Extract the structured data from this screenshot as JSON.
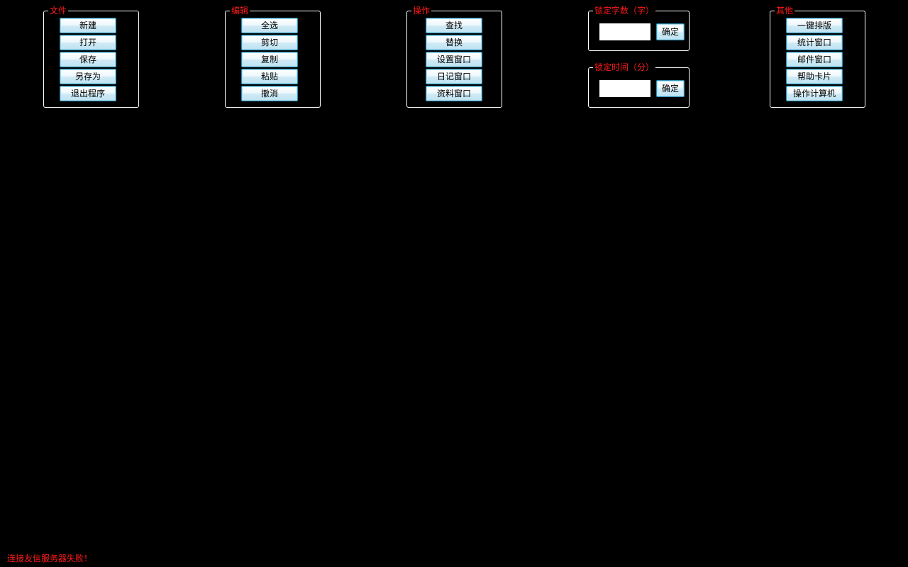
{
  "theme": {
    "background": "#000000",
    "title_color": "#ff1a1a",
    "border_color": "#ffffff",
    "button_border": "#2e8fb7"
  },
  "file_group": {
    "title": "文件",
    "buttons": [
      "新建",
      "打开",
      "保存",
      "另存为",
      "退出程序"
    ]
  },
  "edit_group": {
    "title": "编辑",
    "buttons": [
      "全选",
      "剪切",
      "复制",
      "粘贴",
      "撤消"
    ]
  },
  "operate_group": {
    "title": "操作",
    "buttons": [
      "查找",
      "替换",
      "设置窗口",
      "日记窗口",
      "资料窗口"
    ]
  },
  "lock_words": {
    "title": "锁定字数（字）",
    "value": "",
    "ok_label": "确定"
  },
  "lock_time": {
    "title": "锁定时间（分）",
    "value": "",
    "ok_label": "确定"
  },
  "other_group": {
    "title": "其他",
    "buttons": [
      "一键排版",
      "统计窗口",
      "邮件窗口",
      "帮助卡片",
      "操作计算机"
    ]
  },
  "status": {
    "message": "连接友信服务器失败！"
  }
}
